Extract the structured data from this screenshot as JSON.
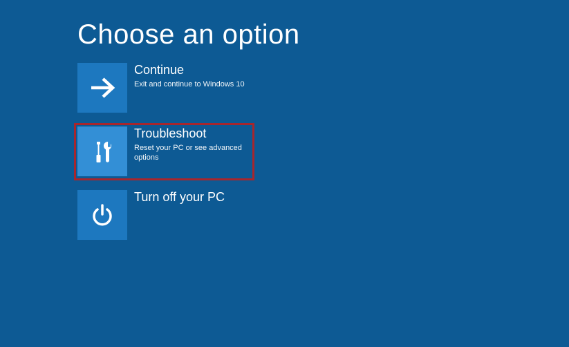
{
  "title": "Choose an option",
  "options": [
    {
      "title": "Continue",
      "desc": "Exit and continue to Windows 10",
      "icon": "arrow-right-icon",
      "highlighted": false
    },
    {
      "title": "Troubleshoot",
      "desc": "Reset your PC or see advanced options",
      "icon": "tools-icon",
      "highlighted": true
    },
    {
      "title": "Turn off your PC",
      "desc": "",
      "icon": "power-icon",
      "highlighted": false
    }
  ],
  "colors": {
    "background": "#0d5a94",
    "tile": "#1d78bf",
    "tileSelected": "#338fd6",
    "highlightBorder": "#a7262d"
  }
}
